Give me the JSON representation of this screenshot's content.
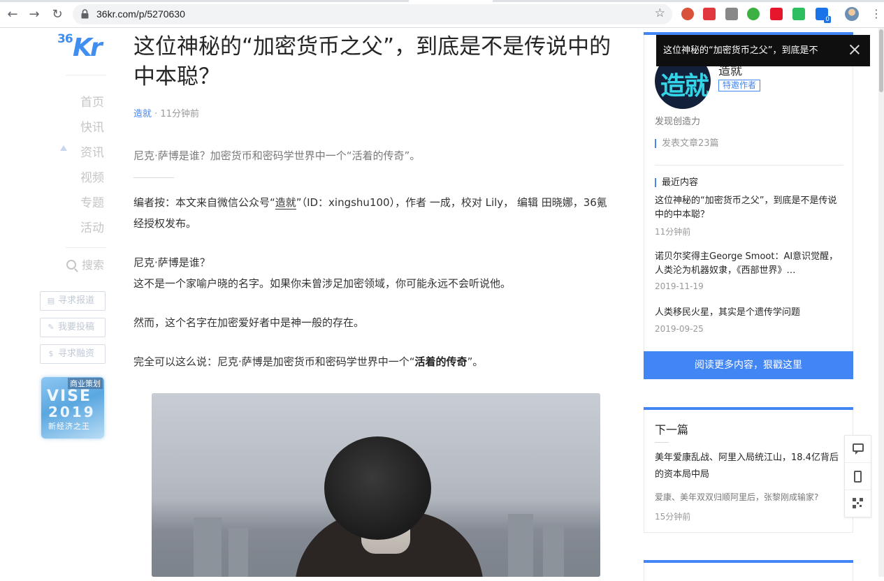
{
  "browser": {
    "url": "36kr.com/p/5270630",
    "back_icon": "←",
    "forward_icon": "→",
    "reload_icon": "↻",
    "star_icon": "☆",
    "menu_icon": "⋮",
    "extensions": [
      {
        "name": "record-extension-icon",
        "color": "#d9533c"
      },
      {
        "name": "red-extension-icon",
        "color": "#e0383e"
      },
      {
        "name": "reader-extension-icon",
        "color": "#888888"
      },
      {
        "name": "green-circle-extension-icon",
        "color": "#3cb043"
      },
      {
        "name": "weibo-extension-icon",
        "color": "#e6162d"
      },
      {
        "name": "evernote-extension-icon",
        "color": "#2dbe60"
      },
      {
        "name": "blue-extension-icon",
        "color": "#1a73e8",
        "badge": "0"
      }
    ]
  },
  "sidebar": {
    "logo_num": "36",
    "logo_kr": "Kr",
    "nav": [
      "首页",
      "快讯",
      "资讯",
      "视频",
      "专题",
      "活动"
    ],
    "search": "搜索",
    "buttons": [
      {
        "icon": "▤",
        "label": "寻求报道"
      },
      {
        "icon": "✎",
        "label": "我要投稿"
      },
      {
        "icon": "$",
        "label": "寻求融资"
      }
    ],
    "promo": {
      "tag": "商业策划",
      "line1": "VISE",
      "line2": "2019",
      "line3": "新经济之王"
    }
  },
  "article": {
    "title": "这位神秘的“加密货币之父”，到底是不是传说中的中本聪？",
    "author": "造就",
    "dot": " · ",
    "time": "11分钟前",
    "summary": "尼克·萨博是谁？加密货币和密码学世界中一个“活着的传奇”。",
    "editor_note_pre": "编者按：本文来自微信公众号“",
    "editor_note_link": "造就",
    "editor_note_post": "”（ID：xingshu100），作者 一成，校对 Lily， 编辑 田晓娜，36氪经授权发布。",
    "p1_line1": "尼克·萨博是谁？",
    "p1_line2": "这不是一个家喻户晓的名字。如果你未曾涉足加密领域，你可能永远不会听说他。",
    "p2": "然而，这个名字在加密爱好者中是神一般的存在。",
    "p3_pre": "完全可以这么说：尼克·萨博是加密货币和密码学世界中一个“",
    "p3_bold": "活着的传奇",
    "p3_post": "”。"
  },
  "author_card": {
    "avatar_glyph": "造就",
    "name": "造就",
    "tag": "特邀作者",
    "desc": "发现创造力",
    "count": "发表文章23篇",
    "recent_heading": "最近内容",
    "recent": [
      {
        "title": "这位神秘的“加密货币之父”，到底是不是传说中的中本聪？",
        "date": "11分钟前"
      },
      {
        "title": "诺贝尔奖得主George Smoot：AI意识觉醒，人类沦为机器奴隶，《西部世界》…",
        "date": "2019-11-19"
      },
      {
        "title": "人类移民火星，其实是个遗传学问题",
        "date": "2019-09-25"
      }
    ],
    "more_button": "阅读更多内容，狠戳这里"
  },
  "next_card": {
    "heading": "下一篇",
    "title": "美年爱康乱战、阿里入局统江山，18.4亿背后的资本局中局",
    "sub": "爱康、美年双双归顺阿里后，张黎刚成输家?",
    "time": "15分钟前"
  },
  "toast": {
    "text": "这位神秘的“加密货币之父”，到底是不"
  },
  "colors": {
    "accent": "#4285f4",
    "toast_bg": "#0f0f0f"
  }
}
